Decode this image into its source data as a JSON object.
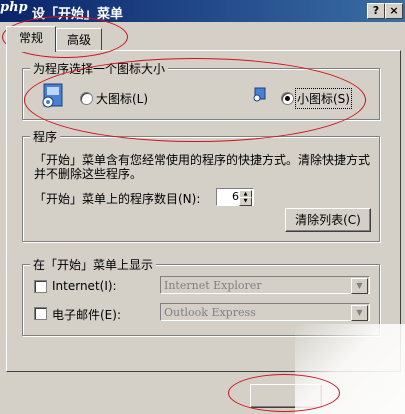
{
  "window": {
    "logo_text": "php",
    "title": "设「开始」菜单",
    "help_button": "?",
    "close_button": "×"
  },
  "tabs": [
    {
      "label": "常规"
    },
    {
      "label": "高级"
    }
  ],
  "icon_size_group": {
    "title": "为程序选择一个图标大小",
    "large_label": "大图标(L)",
    "small_label": "小图标(S)",
    "selected": "small"
  },
  "programs_group": {
    "title": "程序",
    "description_line1": "「开始」菜单含有您经常使用的程序的快捷方式。清除快捷方式",
    "description_line2": "并不删除这些程序。",
    "count_label": "「开始」菜单上的程序数目(N):",
    "count_value": "6",
    "clear_button": "清除列表(C)"
  },
  "show_group": {
    "title": "在「开始」菜单上显示",
    "internet_label": "Internet(I):",
    "internet_value": "Internet Explorer",
    "email_label": "电子邮件(E):",
    "email_value": "Outlook Express"
  },
  "annotation_color": "#d0101a"
}
